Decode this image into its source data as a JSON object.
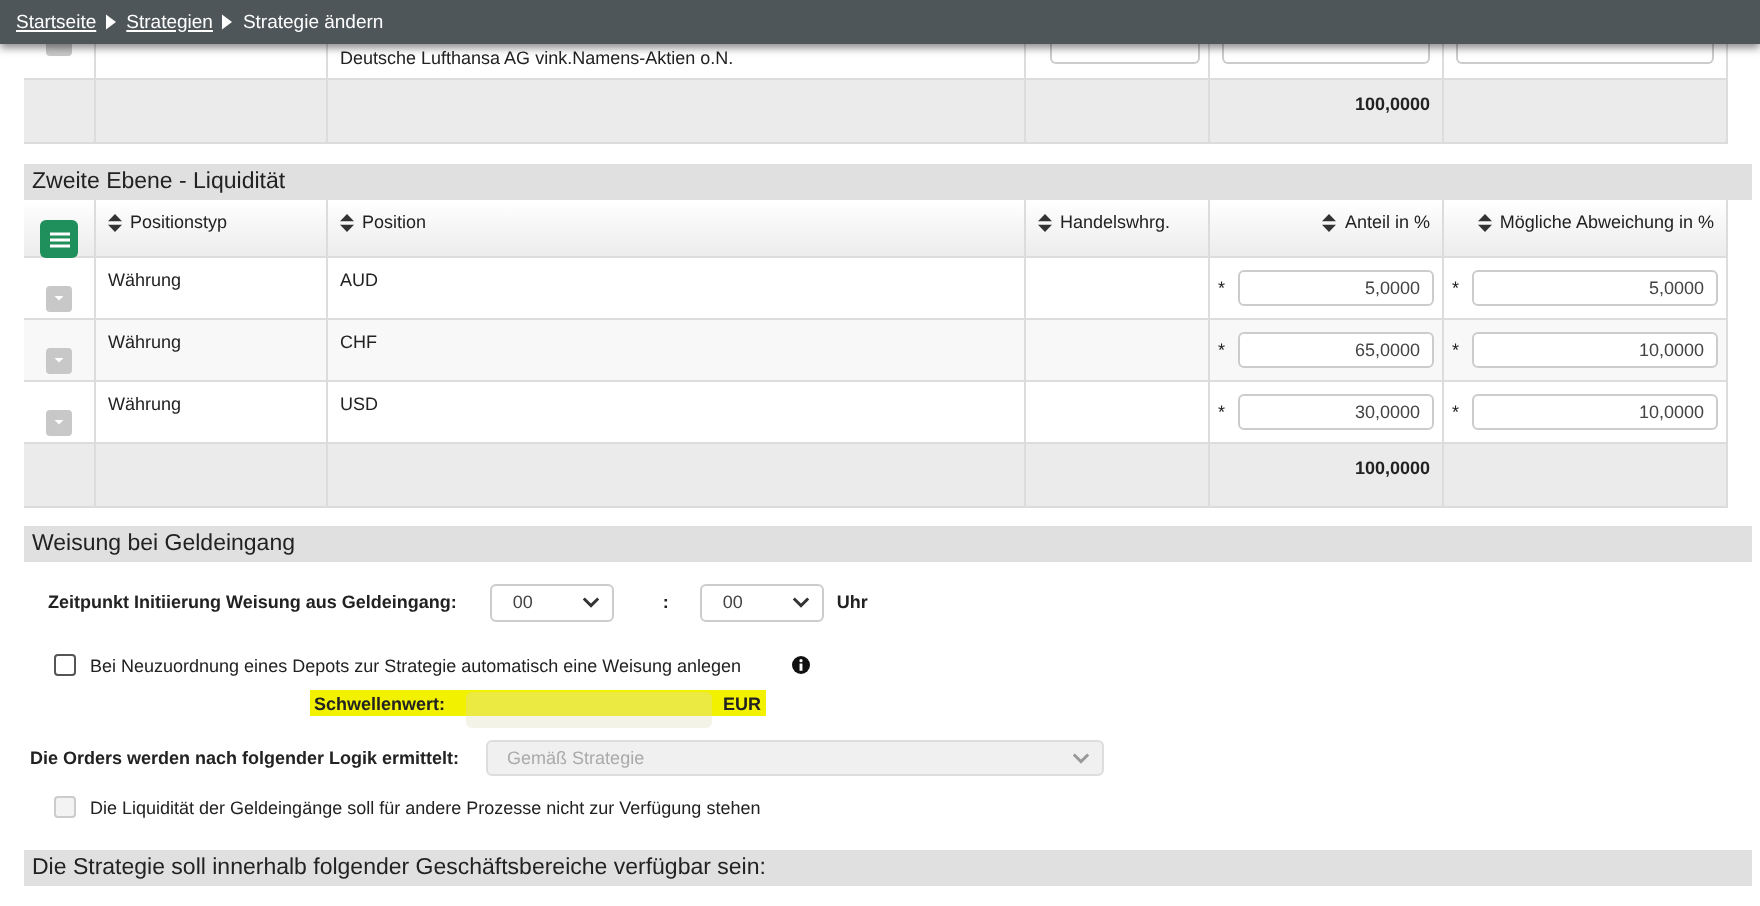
{
  "breadcrumb": [
    {
      "label": "Startseite",
      "link": true
    },
    {
      "label": "Strategien",
      "link": true
    },
    {
      "label": "Strategie ändern",
      "link": false
    }
  ],
  "first_level": {
    "rows": [
      {
        "position": "Deutsche Lufthansa AG vink.Namens-Aktien o.N."
      }
    ],
    "total": "100,0000"
  },
  "liquidity": {
    "title": "Zweite Ebene - Liquidität",
    "columns": [
      {
        "label": "Positionstyp"
      },
      {
        "label": "Position"
      },
      {
        "label": "Handelswhrg."
      },
      {
        "label": "Anteil in %"
      },
      {
        "label": "Mögliche Abweichung in %"
      }
    ],
    "rows": [
      {
        "type": "Währung",
        "position": "AUD",
        "share": {
          "mark": "*",
          "value": "5,0000"
        },
        "deviation": {
          "mark": "*",
          "value": "5,0000"
        }
      },
      {
        "type": "Währung",
        "position": "CHF",
        "share": {
          "mark": "*",
          "value": "65,0000"
        },
        "deviation": {
          "mark": "*",
          "value": "10,0000"
        }
      },
      {
        "type": "Währung",
        "position": "USD",
        "share": {
          "mark": "*",
          "value": "30,0000"
        },
        "deviation": {
          "mark": "*",
          "value": "10,0000"
        }
      }
    ],
    "total": "100,0000"
  },
  "instruction": {
    "title": "Weisung bei Geldeingang",
    "time": {
      "label": "Zeitpunkt Initiierung Weisung aus Geldeingang:",
      "hour": "00",
      "separator": ":",
      "minute": "00",
      "unit": "Uhr"
    },
    "auto_checkbox": {
      "label": "Bei Neuzuordnung eines Depots zur Strategie automatisch eine Weisung anlegen",
      "checked": false,
      "disabled": false
    },
    "threshold": {
      "label": "Schwellenwert:",
      "unit": "EUR",
      "highlighted": true,
      "disabled": true
    },
    "orders": {
      "label": "Die Orders werden nach folgender Logik ermittelt:",
      "value": "Gemäß Strategie",
      "disabled": true
    },
    "liquidity_checkbox": {
      "label": "Die Liquidität der Geldeingänge soll für andere Prozesse nicht zur Verfügung stehen",
      "checked": false,
      "disabled": true
    }
  },
  "availability": {
    "title": "Die Strategie soll innerhalb folgender Geschäftsbereiche verfügbar sein:"
  }
}
